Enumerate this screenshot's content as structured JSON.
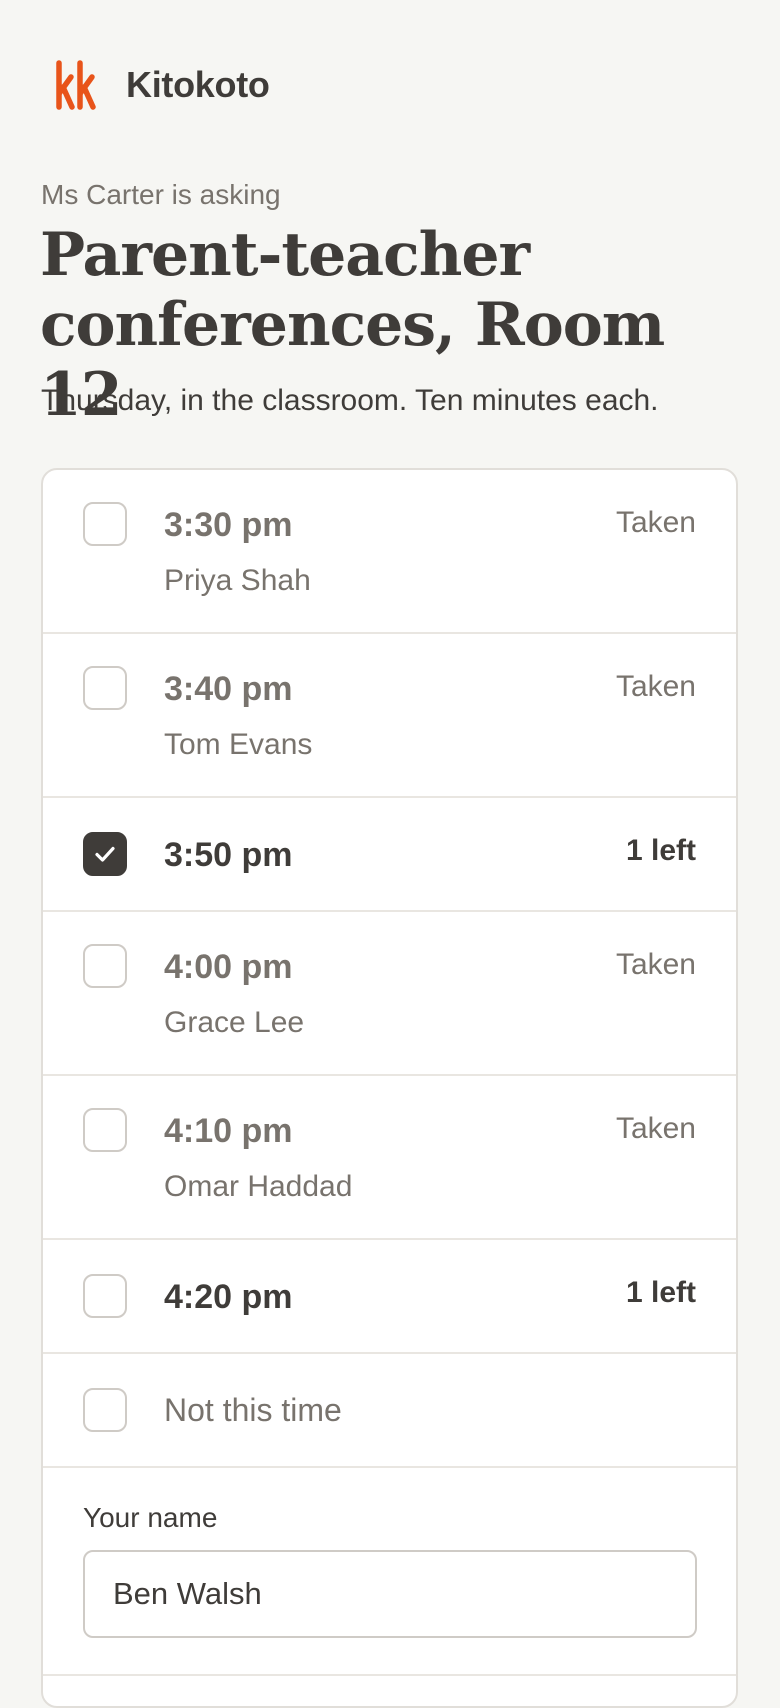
{
  "brand": {
    "name": "Kitokoto",
    "accent_color": "#e8541a"
  },
  "asker": "Ms Carter is asking",
  "title": "Parent-teacher conferences, Room 12",
  "subtitle": "Thursday, in the classroom. Ten minutes each.",
  "slots": [
    {
      "time": "3:30 pm",
      "status": "Taken",
      "name": "Priya Shah",
      "checked": false
    },
    {
      "time": "3:40 pm",
      "status": "Taken",
      "name": "Tom Evans",
      "checked": false
    },
    {
      "time": "3:50 pm",
      "status": "1 left",
      "name": "",
      "checked": true
    },
    {
      "time": "4:00 pm",
      "status": "Taken",
      "name": "Grace Lee",
      "checked": false
    },
    {
      "time": "4:10 pm",
      "status": "Taken",
      "name": "Omar Haddad",
      "checked": false
    },
    {
      "time": "4:20 pm",
      "status": "1 left",
      "name": "",
      "checked": false
    }
  ],
  "not_this_time": {
    "label": "Not this time",
    "checked": false
  },
  "name_field": {
    "label": "Your name",
    "value": "Ben Walsh"
  },
  "colors": {
    "background": "#f6f6f3",
    "text": "#3f3c39",
    "muted": "#78736d",
    "checked_box": "#3f3c39"
  }
}
